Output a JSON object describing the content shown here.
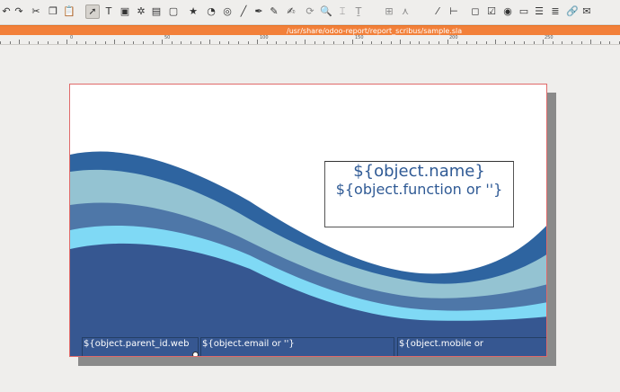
{
  "window": {
    "title": "/usr/share/odoo-report/report_scribus/sample.sla"
  },
  "toolbar": {
    "tools": [
      {
        "name": "undo-icon",
        "glyph": "↶"
      },
      {
        "name": "redo-icon",
        "glyph": "↷"
      },
      {
        "name": "cut-icon",
        "glyph": "✂"
      },
      {
        "name": "copy-icon",
        "glyph": "❐"
      },
      {
        "name": "paste-icon",
        "glyph": "📋"
      },
      {
        "name": "select-icon",
        "glyph": "➚"
      },
      {
        "name": "text-frame-icon",
        "glyph": "T"
      },
      {
        "name": "image-frame-icon",
        "glyph": "▣"
      },
      {
        "name": "render-frame-icon",
        "glyph": "✲"
      },
      {
        "name": "table-icon",
        "glyph": "▤"
      },
      {
        "name": "shape-icon",
        "glyph": "▢"
      },
      {
        "name": "polygon-icon",
        "glyph": "★"
      },
      {
        "name": "arc-icon",
        "glyph": "◔"
      },
      {
        "name": "spiral-icon",
        "glyph": "◎"
      },
      {
        "name": "line-icon",
        "glyph": "╱"
      },
      {
        "name": "bezier-icon",
        "glyph": "✒"
      },
      {
        "name": "freehand-icon",
        "glyph": "✎"
      },
      {
        "name": "calligraphy-icon",
        "glyph": "✍"
      },
      {
        "name": "rotate-icon",
        "glyph": "⟳"
      },
      {
        "name": "zoom-icon",
        "glyph": "🔍"
      },
      {
        "name": "edit-contents-icon",
        "glyph": "⌶"
      },
      {
        "name": "edit-text-icon",
        "glyph": "Ṯ"
      },
      {
        "name": "link-frames-icon",
        "glyph": "⊞"
      },
      {
        "name": "unlink-frames-icon",
        "glyph": "⋏"
      },
      {
        "name": "eyedropper-icon",
        "glyph": "⁄"
      },
      {
        "name": "measure-icon",
        "glyph": "⊢"
      },
      {
        "name": "button-icon",
        "glyph": "◻"
      },
      {
        "name": "checkbox-icon",
        "glyph": "☑"
      },
      {
        "name": "radio-icon",
        "glyph": "◉"
      },
      {
        "name": "textfield-icon",
        "glyph": "▭"
      },
      {
        "name": "combobox-icon",
        "glyph": "☰"
      },
      {
        "name": "listbox-icon",
        "glyph": "≣"
      },
      {
        "name": "annotation-link-icon",
        "glyph": "🔗"
      },
      {
        "name": "annotation-text-icon",
        "glyph": "✉"
      }
    ]
  },
  "ruler": {
    "labels": [
      "0",
      "50",
      "100",
      "150",
      "200",
      "250"
    ]
  },
  "colors": {
    "accent": "#f2803a",
    "wave_dark": "#2e64a0",
    "wave_main": "#365791",
    "wave_light": "#94c3d2",
    "wave_mid": "#4e77a8",
    "wave_cyan": "#7fd9f5",
    "page_border": "#e06a6a"
  },
  "document": {
    "name_field": "${object.name}",
    "function_field": "${object.function or ''}",
    "website_field": "${object.parent_id.web",
    "email_field": "${object.email or ''}",
    "mobile_field": "${object.mobile or"
  }
}
